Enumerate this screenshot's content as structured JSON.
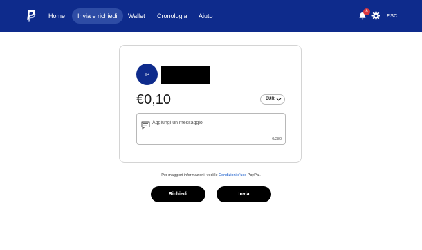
{
  "header": {
    "logo_name": "paypal-logo",
    "nav": [
      {
        "label": "Home",
        "active": false
      },
      {
        "label": "Invia e richiedi",
        "active": true
      },
      {
        "label": "Wallet",
        "active": false
      },
      {
        "label": "Cronologia",
        "active": false
      },
      {
        "label": "Aiuto",
        "active": false
      }
    ],
    "notifications_count": "8",
    "logout_label": "ESCI",
    "bar_color": "#0e2b8c"
  },
  "recipient": {
    "initials": "IP",
    "avatar_color": "#0e2b8c"
  },
  "payment": {
    "amount": "€0,10",
    "currency": "EUR"
  },
  "message": {
    "placeholder": "Aggiungi un messaggio",
    "counter": "0/280"
  },
  "info": {
    "prefix": "Per maggiori informazioni, vedi le",
    "link": "Condizioni d'uso",
    "suffix": "PayPal."
  },
  "actions": {
    "request_label": "Richiedi",
    "send_label": "Invia"
  }
}
